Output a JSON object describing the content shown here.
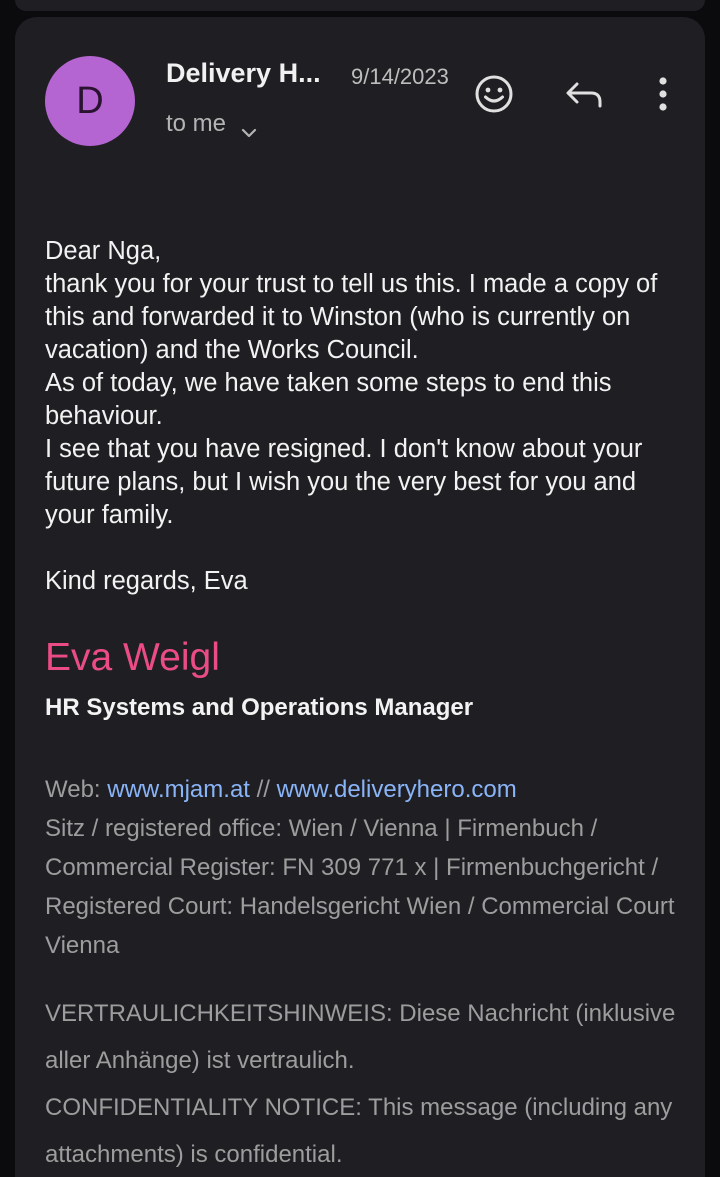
{
  "header": {
    "avatar_letter": "D",
    "sender_name": "Delivery H...",
    "date": "9/14/2023",
    "recipient": "to me",
    "icons": {
      "emoji": "smiley-icon",
      "reply": "reply-icon",
      "more": "more-vertical-icon",
      "expand": "chevron-down-icon"
    }
  },
  "message": {
    "paragraphs": [
      "Dear Nga,",
      "thank you for your trust to tell us this. I made a copy of this and forwarded it to Winston (who is currently on vacation) and the Works Council.",
      "As of today, we have taken some steps to end this behaviour.",
      "I see that you have resigned. I don't know about your future plans, but I wish you the very best for you and your family.",
      "Kind regards, Eva"
    ]
  },
  "signature": {
    "name": "Eva Weigl",
    "title": "HR Systems and Operations Manager",
    "web_label": "Web:",
    "link1": "www.mjam.at",
    "separator": "//",
    "link2": "www.deliveryhero.com",
    "registry_text": "Sitz / registered office: Wien / Vienna | Firmenbuch / Commercial Register: FN 309 771 x | Firmenbuchgericht / Registered Court: Handelsgericht Wien / Commercial Court Vienna"
  },
  "notice": {
    "german": "VERTRAULICHKEITSHINWEIS: Diese Nachricht (inklusive aller Anhänge) ist vertraulich.",
    "english": "CONFIDENTIALITY NOTICE: This message (including any attachments) is confidential."
  },
  "colors": {
    "background": "#0b0b0d",
    "card": "#1f1f23",
    "avatar": "#b565d1",
    "signature_name": "#ec4c86",
    "link": "#8ab4f8",
    "muted_text": "#9d9d9d"
  }
}
